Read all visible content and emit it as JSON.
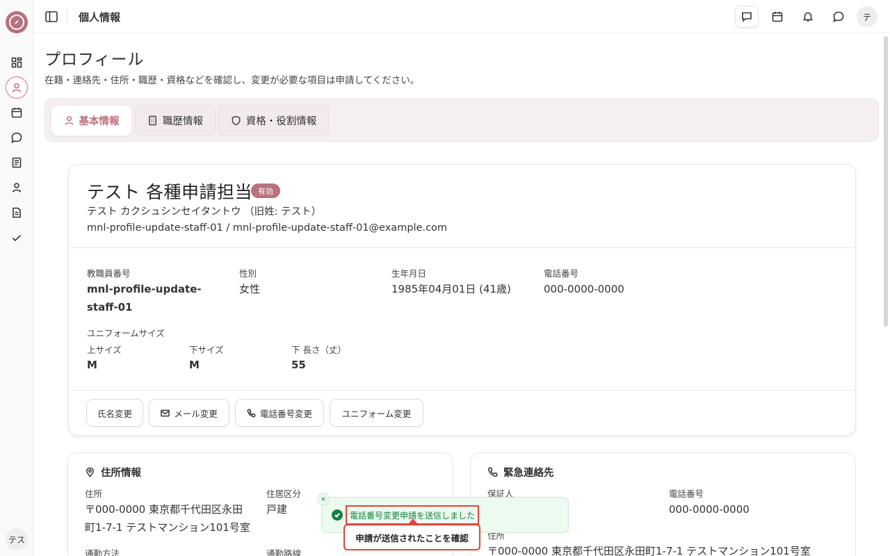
{
  "header": {
    "title": "個人情報",
    "avatar_initial": "テ"
  },
  "sidebar": {
    "avatar_text": "テス"
  },
  "page": {
    "title": "プロフィール",
    "subtitle": "在籍・連絡先・住所・職歴・資格などを確認し、変更が必要な項目は申請してください。"
  },
  "tabs": [
    {
      "label": "基本情報",
      "icon": "user-icon",
      "active": true
    },
    {
      "label": "職歴情報",
      "icon": "building-icon",
      "active": false
    },
    {
      "label": "資格・役割情報",
      "icon": "shield-icon",
      "active": false
    }
  ],
  "profile": {
    "name": "テスト 各種申請担当",
    "status_badge": "有効",
    "kana": "テスト カクシュシンセイタントウ （旧姓: テスト）",
    "account": "mnl-profile-update-staff-01 / mnl-profile-update-staff-01@example.com",
    "fields": {
      "staff_number_label": "教職員番号",
      "staff_number_value": "mnl-profile-update-staff-01",
      "gender_label": "性別",
      "gender_value": "女性",
      "birth_label": "生年月日",
      "birth_value": "1985年04月01日 (41歳)",
      "phone_label": "電話番号",
      "phone_value": "000-0000-0000"
    },
    "uniform": {
      "section_label": "ユニフォームサイズ",
      "top_label": "上サイズ",
      "top_value": "M",
      "bottom_label": "下サイズ",
      "bottom_value": "M",
      "length_label": "下 長さ（丈）",
      "length_value": "55"
    },
    "actions": {
      "name_change": "氏名変更",
      "mail_change": "メール変更",
      "phone_change": "電話番号変更",
      "uniform_change": "ユニフォーム変更"
    }
  },
  "address_card": {
    "title": "住所情報",
    "address_label": "住所",
    "address_line1": "〒000-0000 東京都千代田区永田",
    "address_line2": "町1-7-1 テストマンション101号室",
    "residence_label": "住居区分",
    "residence_value": "戸建",
    "commute_label": "通勤方法",
    "route_label": "通勤路線"
  },
  "emergency_card": {
    "title": "緊急連絡先",
    "guarantor_label": "保証人",
    "phone_label": "電話番号",
    "phone_value": "000-0000-0000",
    "address_label": "住所",
    "address_value": "〒000-0000 東京都千代田区永田町1-7-1 テストマンション101号室"
  },
  "toast": {
    "message": "電話番号変更申請を送信しました",
    "close": "×",
    "callout": "申請が送信されたことを確認"
  },
  "colors": {
    "accent": "#b9717e",
    "success": "#15803d",
    "highlight": "#e0443b"
  }
}
